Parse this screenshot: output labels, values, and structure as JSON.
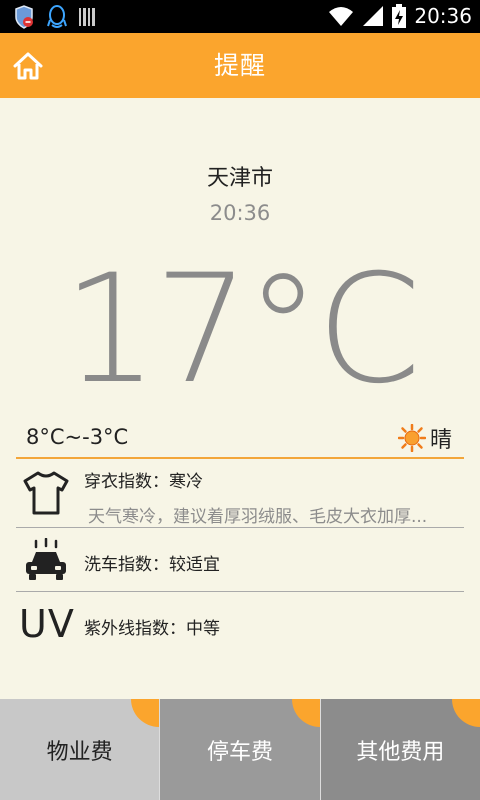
{
  "status_bar": {
    "time": "20:36",
    "icons": [
      "security-shield-icon",
      "qq-icon",
      "barcode-icon",
      "wifi-icon",
      "signal-icon",
      "battery-charging-icon"
    ]
  },
  "header": {
    "title": "提醒",
    "home_icon": "home-icon",
    "background": "#fba52d"
  },
  "weather": {
    "city": "天津市",
    "time": "20:36",
    "temperature": "17°C",
    "range": "8°C~-3°C",
    "condition": "晴",
    "condition_icon": "sun-icon"
  },
  "indices": [
    {
      "icon": "tshirt-icon",
      "title": "穿衣指数：寒冷",
      "description": "天气寒冷，建议着厚羽绒服、毛皮大衣加厚..."
    },
    {
      "icon": "car-wash-icon",
      "title": "洗车指数：较适宜"
    },
    {
      "icon": "uv-icon",
      "icon_text": "UV",
      "title": "紫外线指数：中等"
    }
  ],
  "bottom_buttons": [
    {
      "label": "物业费"
    },
    {
      "label": "停车费"
    },
    {
      "label": "其他费用"
    }
  ],
  "colors": {
    "accent": "#fba52d",
    "background": "#f7f5e6",
    "temperature": "#8a8a8a"
  }
}
